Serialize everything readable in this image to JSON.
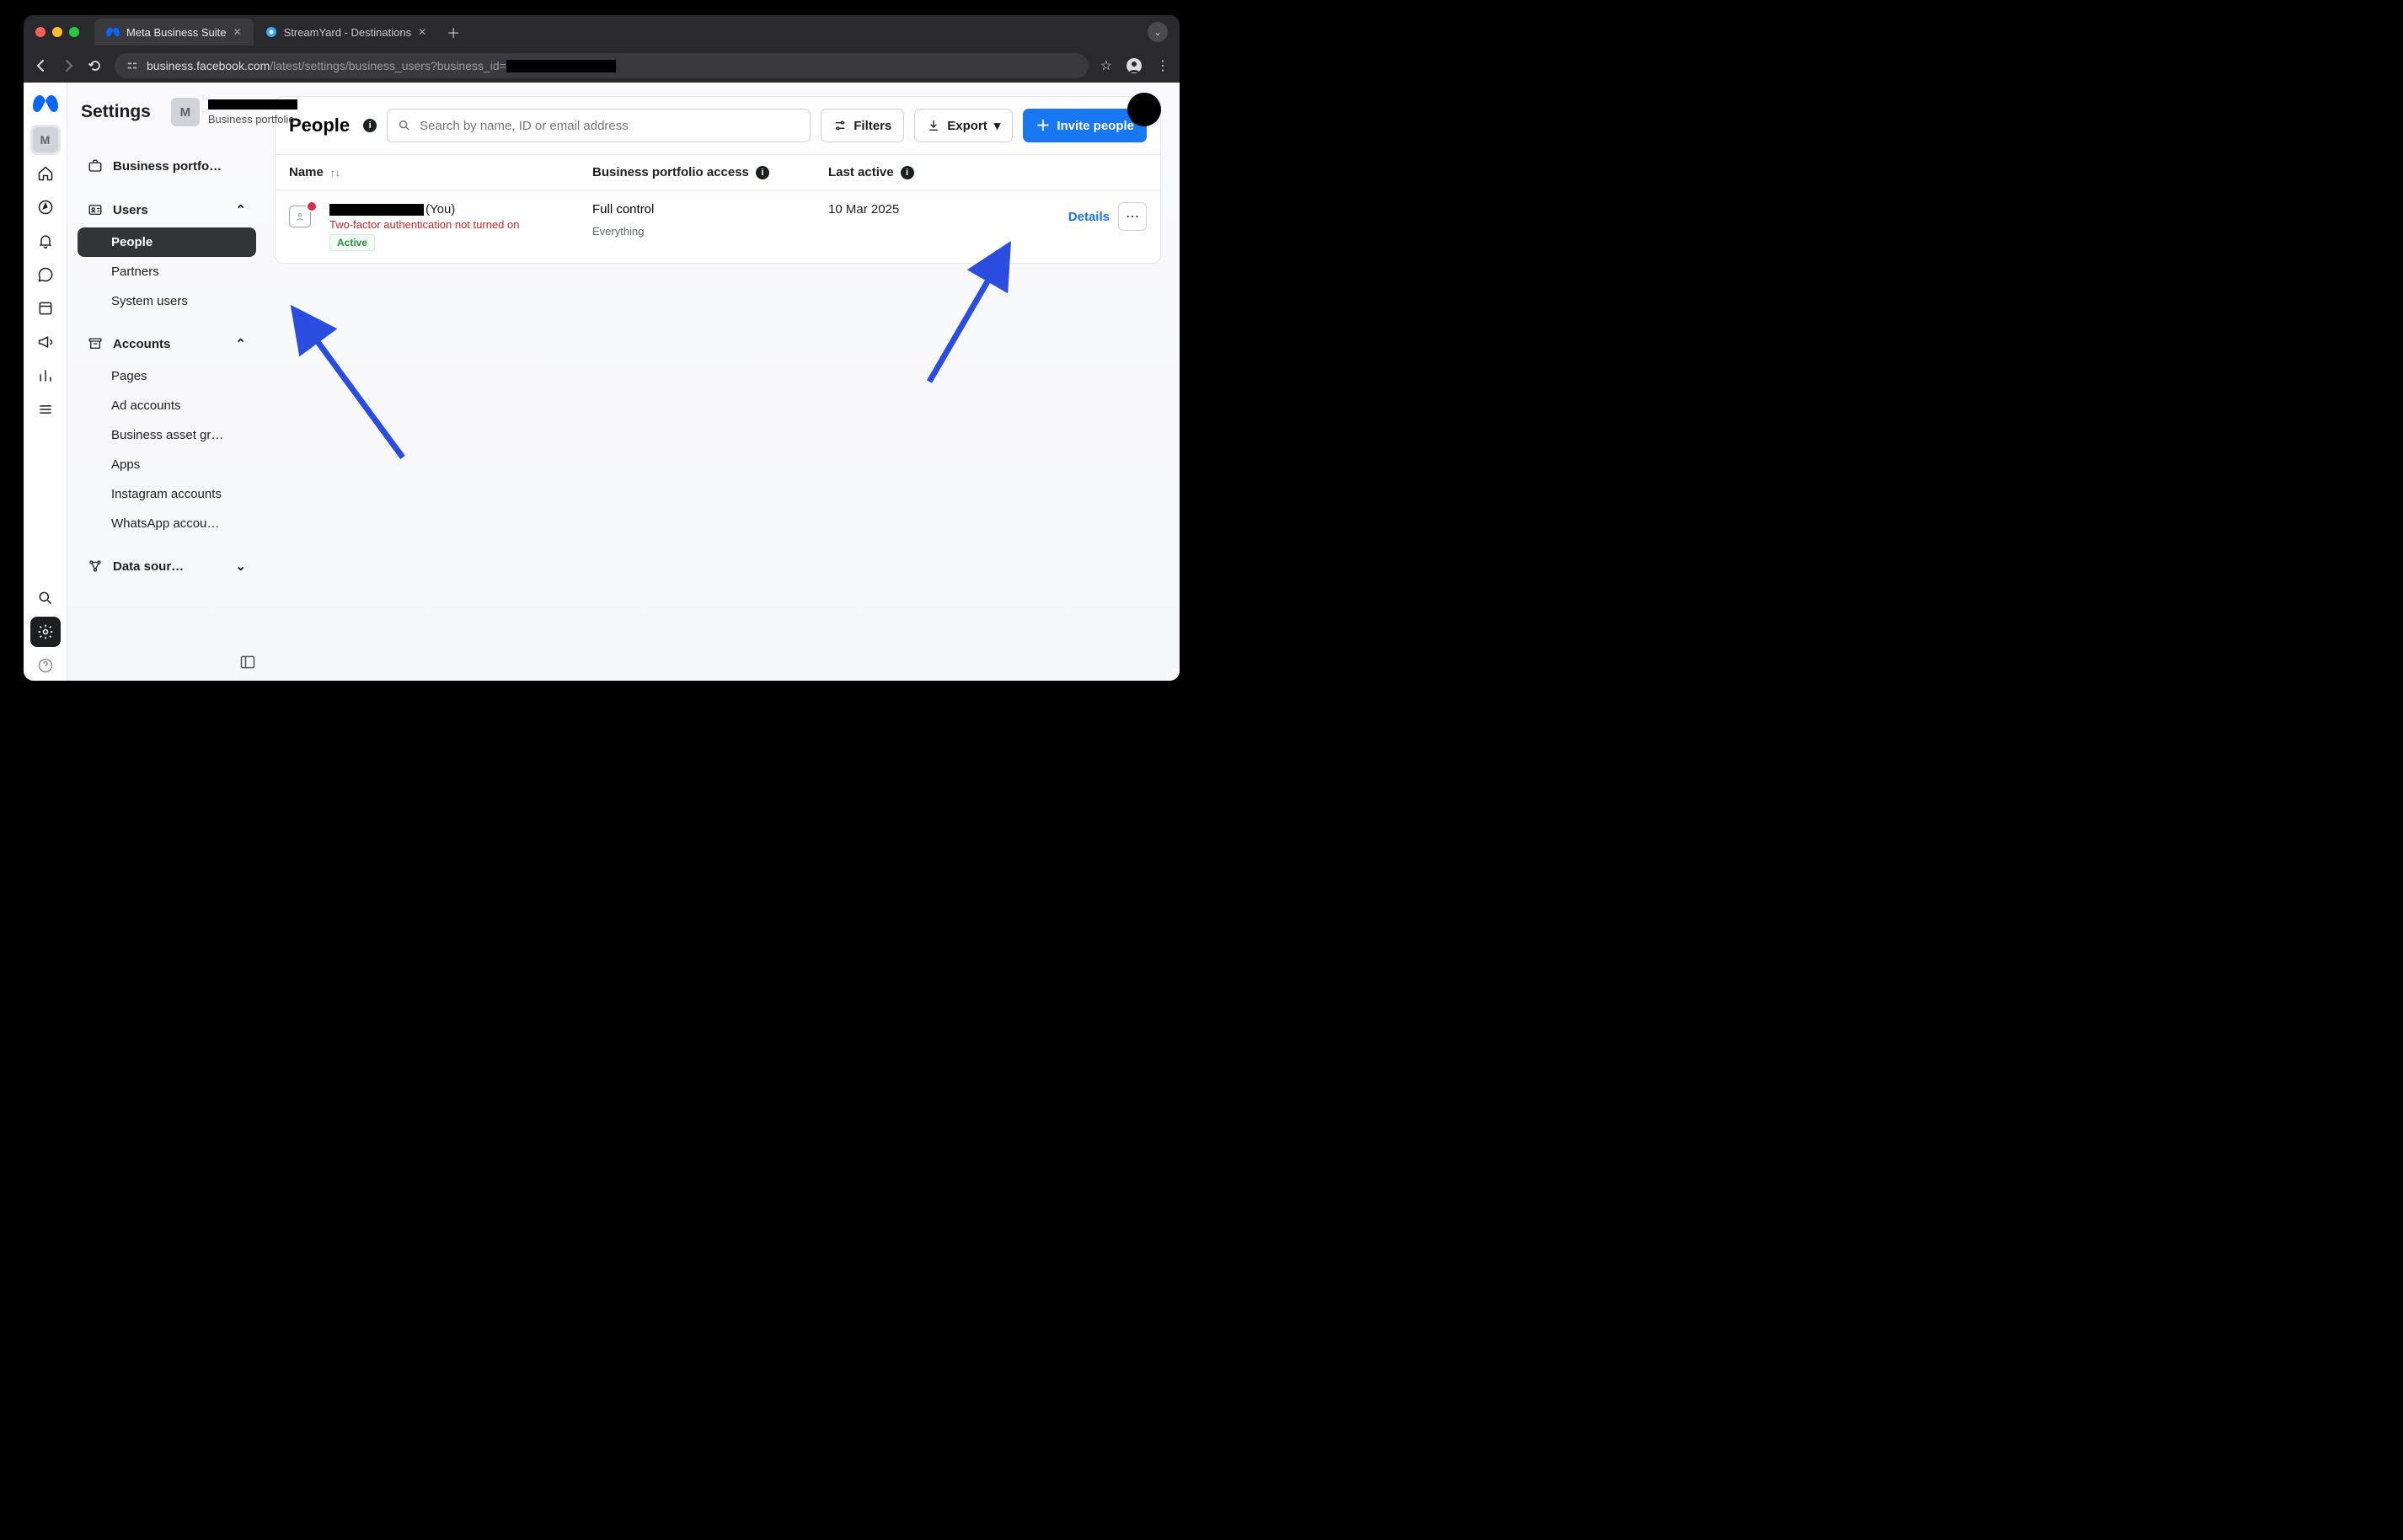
{
  "browser": {
    "tabs": [
      {
        "title": "Meta Business Suite",
        "active": true
      },
      {
        "title": "StreamYard - Destinations",
        "active": false
      }
    ],
    "url_host": "business.facebook.com",
    "url_path": "/latest/settings/business_users?business_id="
  },
  "header": {
    "title": "Settings",
    "portfolio_initial": "M",
    "portfolio_subtitle": "Business portfolio"
  },
  "rail": {
    "account_initial": "M"
  },
  "sidebar": {
    "portfolio_label": "Business portfo…",
    "sections": {
      "users": {
        "label": "Users",
        "items": [
          "People",
          "Partners",
          "System users"
        ],
        "active_index": 0
      },
      "accounts": {
        "label": "Accounts",
        "items": [
          "Pages",
          "Ad accounts",
          "Business asset gr…",
          "Apps",
          "Instagram accounts",
          "WhatsApp accou…"
        ]
      },
      "data_sources": {
        "label": "Data sour…"
      }
    }
  },
  "main": {
    "title": "People",
    "search_placeholder": "Search by name, ID or email address",
    "filters_label": "Filters",
    "export_label": "Export",
    "invite_label": "Invite people",
    "columns": {
      "name": "Name",
      "access": "Business portfolio access",
      "last": "Last active"
    },
    "rows": [
      {
        "you_suffix": "(You)",
        "warning": "Two-factor authentication not turned on",
        "status": "Active",
        "access_main": "Full control",
        "access_sub": "Everything",
        "last_active": "10 Mar 2025",
        "details": "Details"
      }
    ]
  }
}
